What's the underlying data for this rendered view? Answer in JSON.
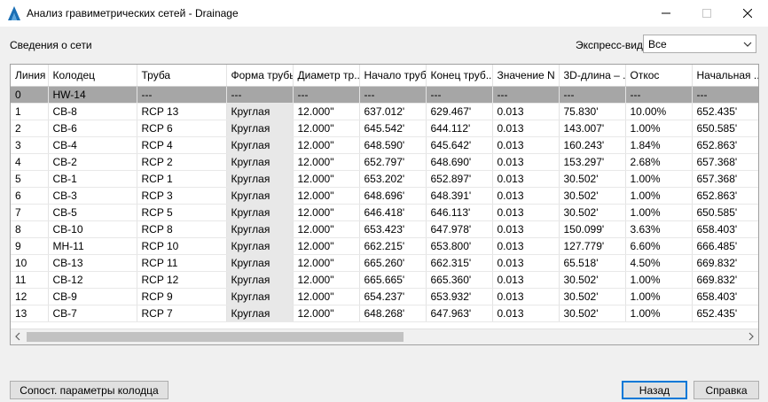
{
  "window": {
    "title": "Анализ гравиметрических сетей - Drainage"
  },
  "network_info_label": "Сведения о сети",
  "express_view": {
    "label": "Экспресс-вид",
    "value": "Все"
  },
  "table": {
    "headers": [
      "Линия",
      "Колодец",
      "Труба",
      "Форма трубы",
      "Диаметр тр...",
      "Начало труб...",
      "Конец труб...",
      "Значение N",
      "3D-длина – ...",
      "Откос",
      "Начальная ..."
    ],
    "rows": [
      [
        "0",
        "HW-14",
        "---",
        "---",
        "---",
        "---",
        "---",
        "---",
        "---",
        "---",
        "---"
      ],
      [
        "1",
        "CB-8",
        "RCP 13",
        "Круглая",
        "12.000\"",
        "637.012'",
        "629.467'",
        "0.013",
        "75.830'",
        "10.00%",
        "652.435'"
      ],
      [
        "2",
        "CB-6",
        "RCP 6",
        "Круглая",
        "12.000\"",
        "645.542'",
        "644.112'",
        "0.013",
        "143.007'",
        "1.00%",
        "650.585'"
      ],
      [
        "3",
        "CB-4",
        "RCP 4",
        "Круглая",
        "12.000\"",
        "648.590'",
        "645.642'",
        "0.013",
        "160.243'",
        "1.84%",
        "652.863'"
      ],
      [
        "4",
        "CB-2",
        "RCP 2",
        "Круглая",
        "12.000\"",
        "652.797'",
        "648.690'",
        "0.013",
        "153.297'",
        "2.68%",
        "657.368'"
      ],
      [
        "5",
        "CB-1",
        "RCP 1",
        "Круглая",
        "12.000\"",
        "653.202'",
        "652.897'",
        "0.013",
        "30.502'",
        "1.00%",
        "657.368'"
      ],
      [
        "6",
        "CB-3",
        "RCP 3",
        "Круглая",
        "12.000\"",
        "648.696'",
        "648.391'",
        "0.013",
        "30.502'",
        "1.00%",
        "652.863'"
      ],
      [
        "7",
        "CB-5",
        "RCP 5",
        "Круглая",
        "12.000\"",
        "646.418'",
        "646.113'",
        "0.013",
        "30.502'",
        "1.00%",
        "650.585'"
      ],
      [
        "8",
        "CB-10",
        "RCP 8",
        "Круглая",
        "12.000\"",
        "653.423'",
        "647.978'",
        "0.013",
        "150.099'",
        "3.63%",
        "658.403'"
      ],
      [
        "9",
        "MH-11",
        "RCP 10",
        "Круглая",
        "12.000\"",
        "662.215'",
        "653.800'",
        "0.013",
        "127.779'",
        "6.60%",
        "666.485'"
      ],
      [
        "10",
        "CB-13",
        "RCP 11",
        "Круглая",
        "12.000\"",
        "665.260'",
        "662.315'",
        "0.013",
        "65.518'",
        "4.50%",
        "669.832'"
      ],
      [
        "11",
        "CB-12",
        "RCP 12",
        "Круглая",
        "12.000\"",
        "665.665'",
        "665.360'",
        "0.013",
        "30.502'",
        "1.00%",
        "669.832'"
      ],
      [
        "12",
        "CB-9",
        "RCP 9",
        "Круглая",
        "12.000\"",
        "654.237'",
        "653.932'",
        "0.013",
        "30.502'",
        "1.00%",
        "658.403'"
      ],
      [
        "13",
        "CB-7",
        "RCP 7",
        "Круглая",
        "12.000\"",
        "648.268'",
        "647.963'",
        "0.013",
        "30.502'",
        "1.00%",
        "652.435'"
      ]
    ]
  },
  "buttons": {
    "wells": "Сопост. параметры колодца",
    "back": "Назад",
    "help": "Справка"
  },
  "colors": {
    "accent": "#0078d7",
    "selected_row": "#a6a6a6",
    "readonly_cell": "#e8e8e8"
  }
}
